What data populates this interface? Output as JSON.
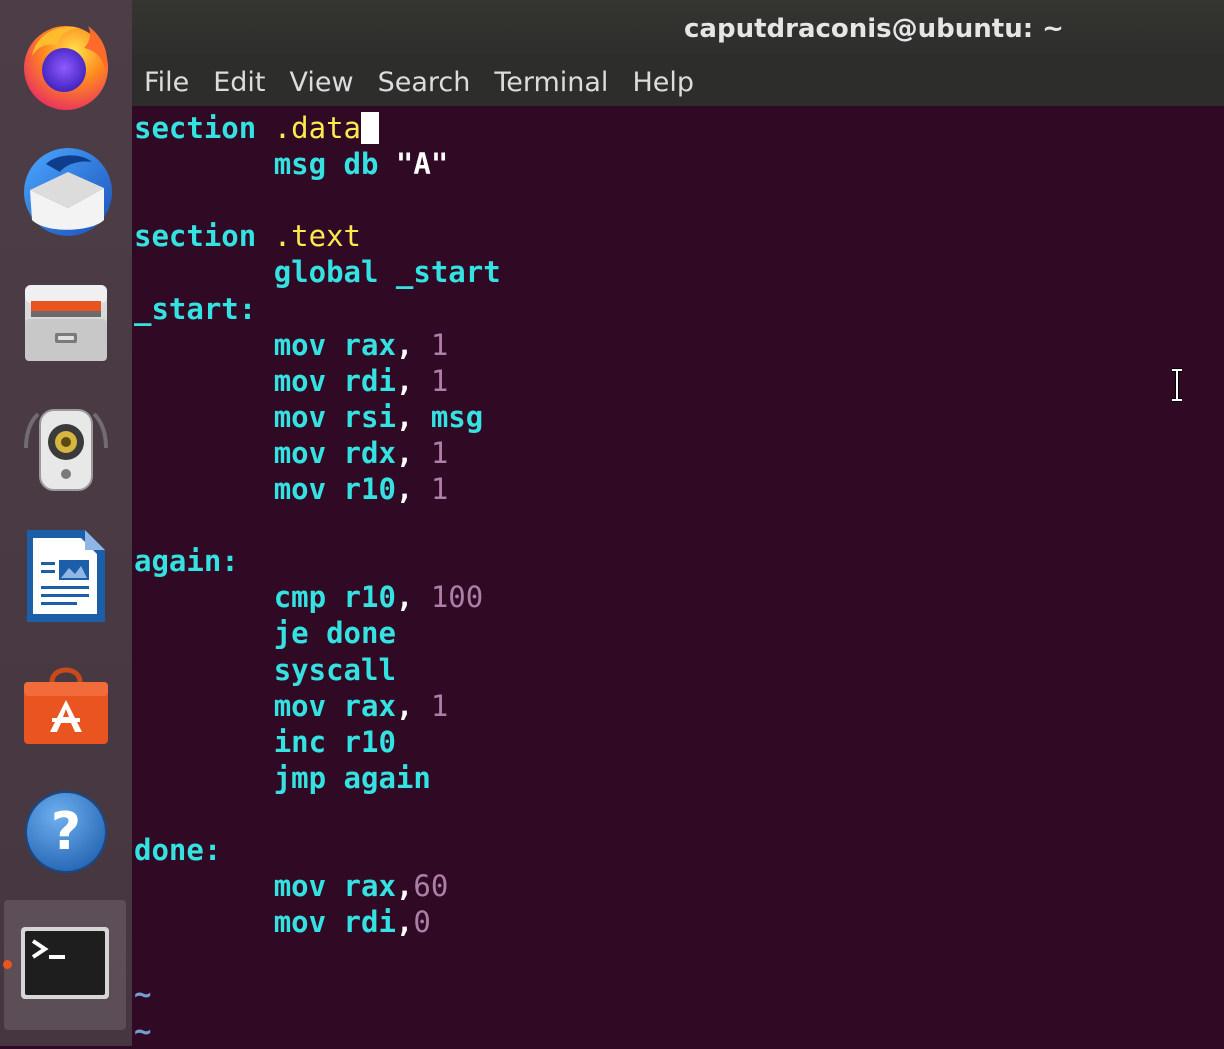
{
  "window": {
    "title": "caputdraconis@ubuntu: ~"
  },
  "menubar": {
    "items": [
      "File",
      "Edit",
      "View",
      "Search",
      "Terminal",
      "Help"
    ]
  },
  "dock": {
    "apps": [
      {
        "name": "Firefox Web Browser",
        "icon": "firefox-icon"
      },
      {
        "name": "Thunderbird Mail",
        "icon": "thunderbird-icon"
      },
      {
        "name": "Files",
        "icon": "files-icon"
      },
      {
        "name": "Rhythmbox",
        "icon": "rhythmbox-icon"
      },
      {
        "name": "LibreOffice Writer",
        "icon": "libreoffice-writer-icon"
      },
      {
        "name": "Ubuntu Software",
        "icon": "ubuntu-software-icon"
      },
      {
        "name": "Help",
        "icon": "help-icon"
      },
      {
        "name": "Terminal",
        "icon": "terminal-icon",
        "active": true
      }
    ],
    "accent_color": "#e95420"
  },
  "editor": {
    "background": "#300a24",
    "lines": [
      {
        "indent": "",
        "tokens": [
          {
            "t": "section",
            "c": "kw"
          },
          {
            "t": " ",
            "c": "punc"
          },
          {
            "t": ".data",
            "c": "dir"
          }
        ],
        "cursor": true
      },
      {
        "indent": "        ",
        "tokens": [
          {
            "t": "msg db ",
            "c": "kw"
          },
          {
            "t": "\"A\"",
            "c": "str"
          }
        ]
      },
      {
        "indent": "",
        "tokens": []
      },
      {
        "indent": "",
        "tokens": [
          {
            "t": "section",
            "c": "kw"
          },
          {
            "t": " ",
            "c": "punc"
          },
          {
            "t": ".text",
            "c": "dir"
          }
        ]
      },
      {
        "indent": "        ",
        "tokens": [
          {
            "t": "global _start",
            "c": "kw"
          }
        ]
      },
      {
        "indent": "",
        "tokens": [
          {
            "t": "_start:",
            "c": "kw"
          }
        ]
      },
      {
        "indent": "        ",
        "tokens": [
          {
            "t": "mov rax",
            "c": "kw"
          },
          {
            "t": ", ",
            "c": "punc"
          },
          {
            "t": "1",
            "c": "num"
          }
        ]
      },
      {
        "indent": "        ",
        "tokens": [
          {
            "t": "mov rdi",
            "c": "kw"
          },
          {
            "t": ", ",
            "c": "punc"
          },
          {
            "t": "1",
            "c": "num"
          }
        ]
      },
      {
        "indent": "        ",
        "tokens": [
          {
            "t": "mov rsi",
            "c": "kw"
          },
          {
            "t": ", ",
            "c": "punc"
          },
          {
            "t": "msg",
            "c": "kw"
          }
        ]
      },
      {
        "indent": "        ",
        "tokens": [
          {
            "t": "mov rdx",
            "c": "kw"
          },
          {
            "t": ", ",
            "c": "punc"
          },
          {
            "t": "1",
            "c": "num"
          }
        ]
      },
      {
        "indent": "        ",
        "tokens": [
          {
            "t": "mov r10",
            "c": "kw"
          },
          {
            "t": ", ",
            "c": "punc"
          },
          {
            "t": "1",
            "c": "num"
          }
        ]
      },
      {
        "indent": "",
        "tokens": []
      },
      {
        "indent": "",
        "tokens": [
          {
            "t": "again:",
            "c": "kw"
          }
        ]
      },
      {
        "indent": "        ",
        "tokens": [
          {
            "t": "cmp r10",
            "c": "kw"
          },
          {
            "t": ", ",
            "c": "punc"
          },
          {
            "t": "100",
            "c": "num"
          }
        ]
      },
      {
        "indent": "        ",
        "tokens": [
          {
            "t": "je done",
            "c": "kw"
          }
        ]
      },
      {
        "indent": "        ",
        "tokens": [
          {
            "t": "syscall",
            "c": "kw"
          }
        ]
      },
      {
        "indent": "        ",
        "tokens": [
          {
            "t": "mov rax",
            "c": "kw"
          },
          {
            "t": ", ",
            "c": "punc"
          },
          {
            "t": "1",
            "c": "num"
          }
        ]
      },
      {
        "indent": "        ",
        "tokens": [
          {
            "t": "inc r10",
            "c": "kw"
          }
        ]
      },
      {
        "indent": "        ",
        "tokens": [
          {
            "t": "jmp again",
            "c": "kw"
          }
        ]
      },
      {
        "indent": "",
        "tokens": []
      },
      {
        "indent": "",
        "tokens": [
          {
            "t": "done:",
            "c": "kw"
          }
        ]
      },
      {
        "indent": "        ",
        "tokens": [
          {
            "t": "mov rax",
            "c": "kw"
          },
          {
            "t": ",",
            "c": "punc"
          },
          {
            "t": "60",
            "c": "num"
          }
        ]
      },
      {
        "indent": "        ",
        "tokens": [
          {
            "t": "mov rdi",
            "c": "kw"
          },
          {
            "t": ",",
            "c": "punc"
          },
          {
            "t": "0",
            "c": "num"
          }
        ]
      },
      {
        "indent": "",
        "tokens": []
      },
      {
        "indent": "",
        "tokens": [
          {
            "t": "~",
            "c": "tilde"
          }
        ]
      },
      {
        "indent": "",
        "tokens": [
          {
            "t": "~",
            "c": "tilde"
          }
        ]
      }
    ]
  }
}
